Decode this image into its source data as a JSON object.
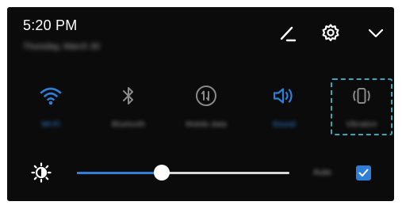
{
  "status": {
    "time": "5:20 PM",
    "date": "Thursday, March 30"
  },
  "header_icons": [
    "edit-icon",
    "gear-icon",
    "chevron-down-icon"
  ],
  "toggles": [
    {
      "label": "Wi-Fi",
      "icon": "wifi-icon",
      "state": "on"
    },
    {
      "label": "Bluetooth",
      "icon": "bluetooth-icon",
      "state": "off"
    },
    {
      "label": "Mobile data",
      "icon": "mobile-data-icon",
      "state": "off"
    },
    {
      "label": "Sound",
      "icon": "sound-icon",
      "state": "on"
    },
    {
      "label": "Vibration",
      "icon": "vibration-icon",
      "state": "off"
    }
  ],
  "brightness": {
    "icon": "brightness-icon",
    "level": 0.4,
    "auto_label": "Auto",
    "auto_checked": true
  },
  "colors": {
    "accent": "#2f7fd8",
    "panel": "#0b0b0b",
    "highlight": "#3ba6b5",
    "inactive": "#8a8a8a"
  }
}
